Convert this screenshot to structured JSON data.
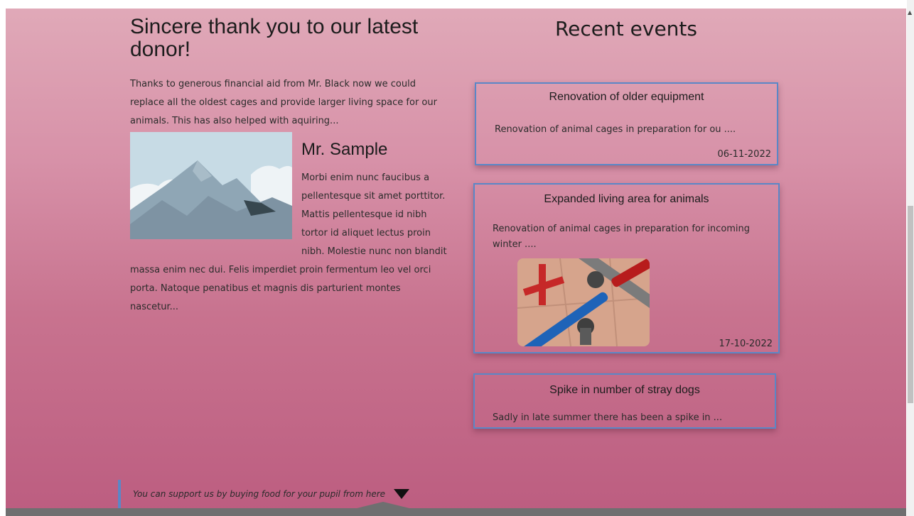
{
  "donor": {
    "title": "Sincere thank you to our latest donor!",
    "intro": "Thanks to generous financial aid from Mr. Black now we could replace all the oldest cages and provide larger living space for our animals. This has also helped with aquiring...",
    "name": "Mr. Sample",
    "quote": "Morbi enim nunc faucibus a pellentesque sit amet porttitor. Mattis pellentesque id nibh tortor id aliquet lectus proin nibh. Molestie nunc non blandit massa enim nec dui. Felis imperdiet proin fermentum leo vel orci porta. Natoque penatibus et magnis dis parturient montes nascetur..."
  },
  "events": {
    "title": "Recent events",
    "items": [
      {
        "title": "Renovation of older equipment",
        "summary": "Renovation of animal cages in preparation for ou ....",
        "date": "06-11-2022"
      },
      {
        "title": "Expanded living area for animals",
        "summary": "Renovation of animal cages in preparation for incoming winter ....",
        "date": "17-10-2022"
      },
      {
        "title": "Spike in number of stray dogs",
        "summary": "Sadly in late summer there has been a spike in ..."
      }
    ]
  },
  "support": {
    "text": "You can support us by buying food for your pupil from here"
  },
  "colors": {
    "accent_border": "#5a87c7",
    "gradient_top": "#e0a9b8",
    "gradient_bottom": "#bc5d80"
  },
  "icons": {
    "support_arrow": "triangle-down-icon"
  }
}
